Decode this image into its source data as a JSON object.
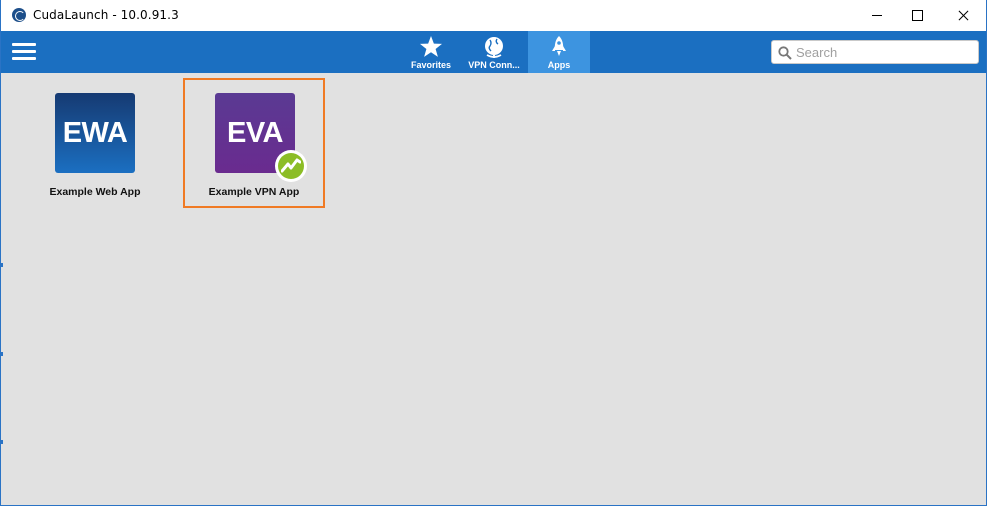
{
  "window": {
    "title": "CudaLaunch - 10.0.91.3",
    "colors": {
      "toolbar": "#1b6fc1",
      "active_tab": "#3d94e0",
      "selection": "#f07a24",
      "content_bg": "#e1e1e1"
    }
  },
  "toolbar": {
    "menu_icon": "hamburger-menu-icon",
    "tabs": [
      {
        "label": "Favorites",
        "icon": "star-icon",
        "active": false
      },
      {
        "label": "VPN Conn...",
        "icon": "globe-icon",
        "active": false
      },
      {
        "label": "Apps",
        "icon": "rocket-icon",
        "active": true
      }
    ],
    "search": {
      "placeholder": "Search",
      "value": "",
      "icon": "search-icon"
    }
  },
  "apps": [
    {
      "abbr": "EWA",
      "label": "Example Web App",
      "color": "#1b5aa6",
      "selected": false
    },
    {
      "abbr": "EVA",
      "label": "Example VPN App",
      "color": "#5e3391",
      "selected": true,
      "badge": "vpn-badge-icon",
      "badge_color": "#8cbd26"
    }
  ]
}
